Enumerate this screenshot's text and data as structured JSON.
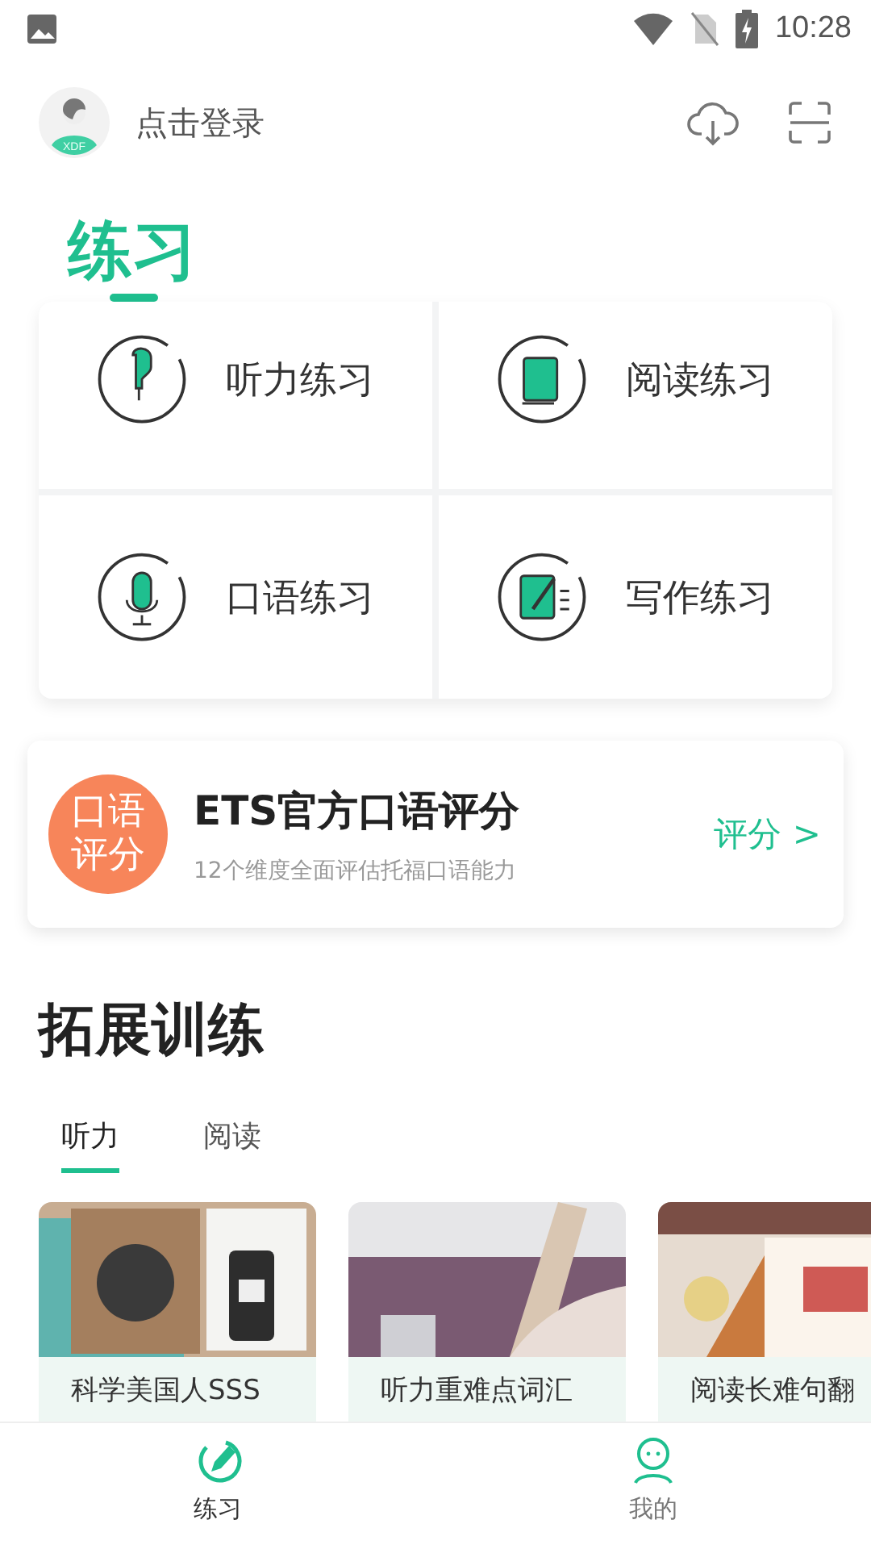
{
  "status_bar": {
    "time": "10:28"
  },
  "header": {
    "login": "点击登录",
    "avatar_label": "XDF"
  },
  "practice": {
    "title": "练习",
    "items": [
      {
        "label": "听力练习",
        "kind": "listening"
      },
      {
        "label": "阅读练习",
        "kind": "reading"
      },
      {
        "label": "口语练习",
        "kind": "speaking"
      },
      {
        "label": "写作练习",
        "kind": "writing"
      }
    ]
  },
  "ets_card": {
    "badge": "口语评分",
    "title": "ETS官方口语评分",
    "subtitle": "12个维度全面评估托福口语能力",
    "action": "评分 >"
  },
  "extended": {
    "title": "拓展训练",
    "tabs": [
      {
        "label": "听力",
        "selected": true
      },
      {
        "label": "阅读",
        "selected": false
      }
    ],
    "courses": [
      {
        "title": "科学美国人SSS",
        "kind": "picture"
      },
      {
        "title": "听力重难点词汇",
        "kind": "picture"
      },
      {
        "title": "阅读长难句翻",
        "kind": "picture"
      }
    ]
  },
  "bottom_nav": [
    {
      "label": "练习",
      "kind": "practice",
      "selected": true
    },
    {
      "label": "我的",
      "kind": "profile",
      "selected": false
    }
  ]
}
